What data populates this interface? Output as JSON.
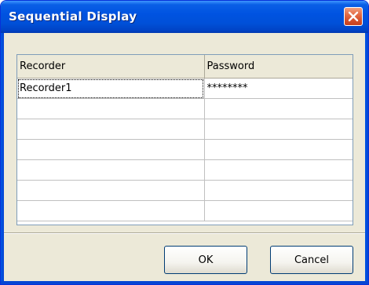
{
  "window": {
    "title": "Sequential Display"
  },
  "grid": {
    "columns": [
      "Recorder",
      "Password"
    ],
    "rows": [
      [
        "Recorder1",
        "********"
      ],
      [
        "",
        ""
      ],
      [
        "",
        ""
      ],
      [
        "",
        ""
      ],
      [
        "",
        ""
      ],
      [
        "",
        ""
      ],
      [
        "",
        ""
      ]
    ]
  },
  "buttons": {
    "ok_label": "OK",
    "cancel_label": "Cancel"
  },
  "icons": {
    "close": "close-icon"
  }
}
